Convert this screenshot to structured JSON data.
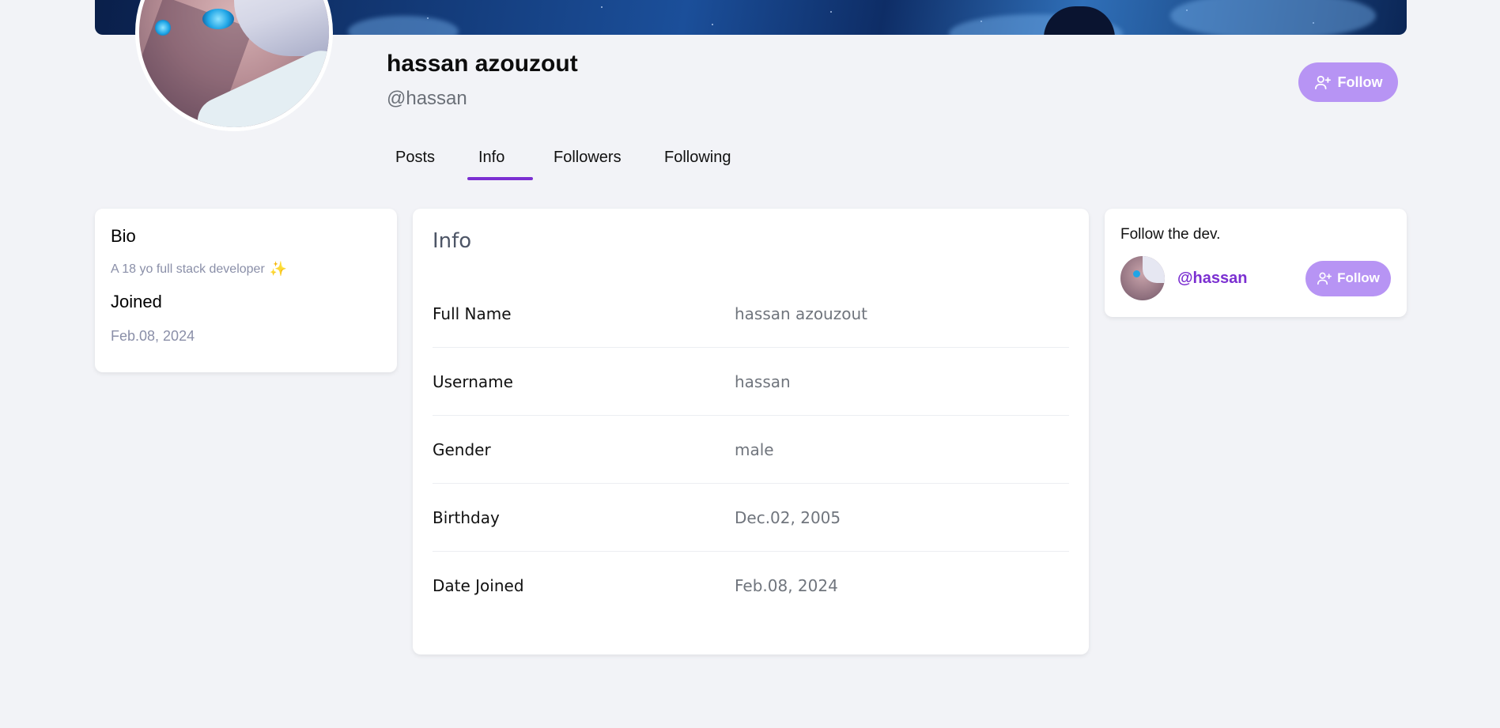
{
  "profile": {
    "name": "hassan azouzout",
    "handle": "@hassan",
    "follow_label": "Follow"
  },
  "tabs": [
    {
      "label": "Posts",
      "active": false
    },
    {
      "label": "Info",
      "active": true
    },
    {
      "label": "Followers",
      "active": false
    },
    {
      "label": "Following",
      "active": false
    }
  ],
  "bio": {
    "heading": "Bio",
    "text": "A 18 yo full stack developer",
    "emoji": "✨",
    "joined_heading": "Joined",
    "joined_value": "Feb.08, 2024"
  },
  "info": {
    "title": "Info",
    "rows": [
      {
        "label": "Full Name",
        "value": "hassan azouzout"
      },
      {
        "label": "Username",
        "value": "hassan"
      },
      {
        "label": "Gender",
        "value": "male"
      },
      {
        "label": "Birthday",
        "value": "Dec.02, 2005"
      },
      {
        "label": "Date Joined",
        "value": "Feb.08, 2024"
      }
    ]
  },
  "follow_dev": {
    "title": "Follow the dev.",
    "handle": "@hassan",
    "follow_label": "Follow"
  },
  "colors": {
    "accent": "#7b2fd1",
    "button": "#b794f4",
    "background": "#f2f3f7"
  },
  "icons": {
    "follow": "user-plus-icon",
    "bio_emoji": "sparkle-icon"
  }
}
